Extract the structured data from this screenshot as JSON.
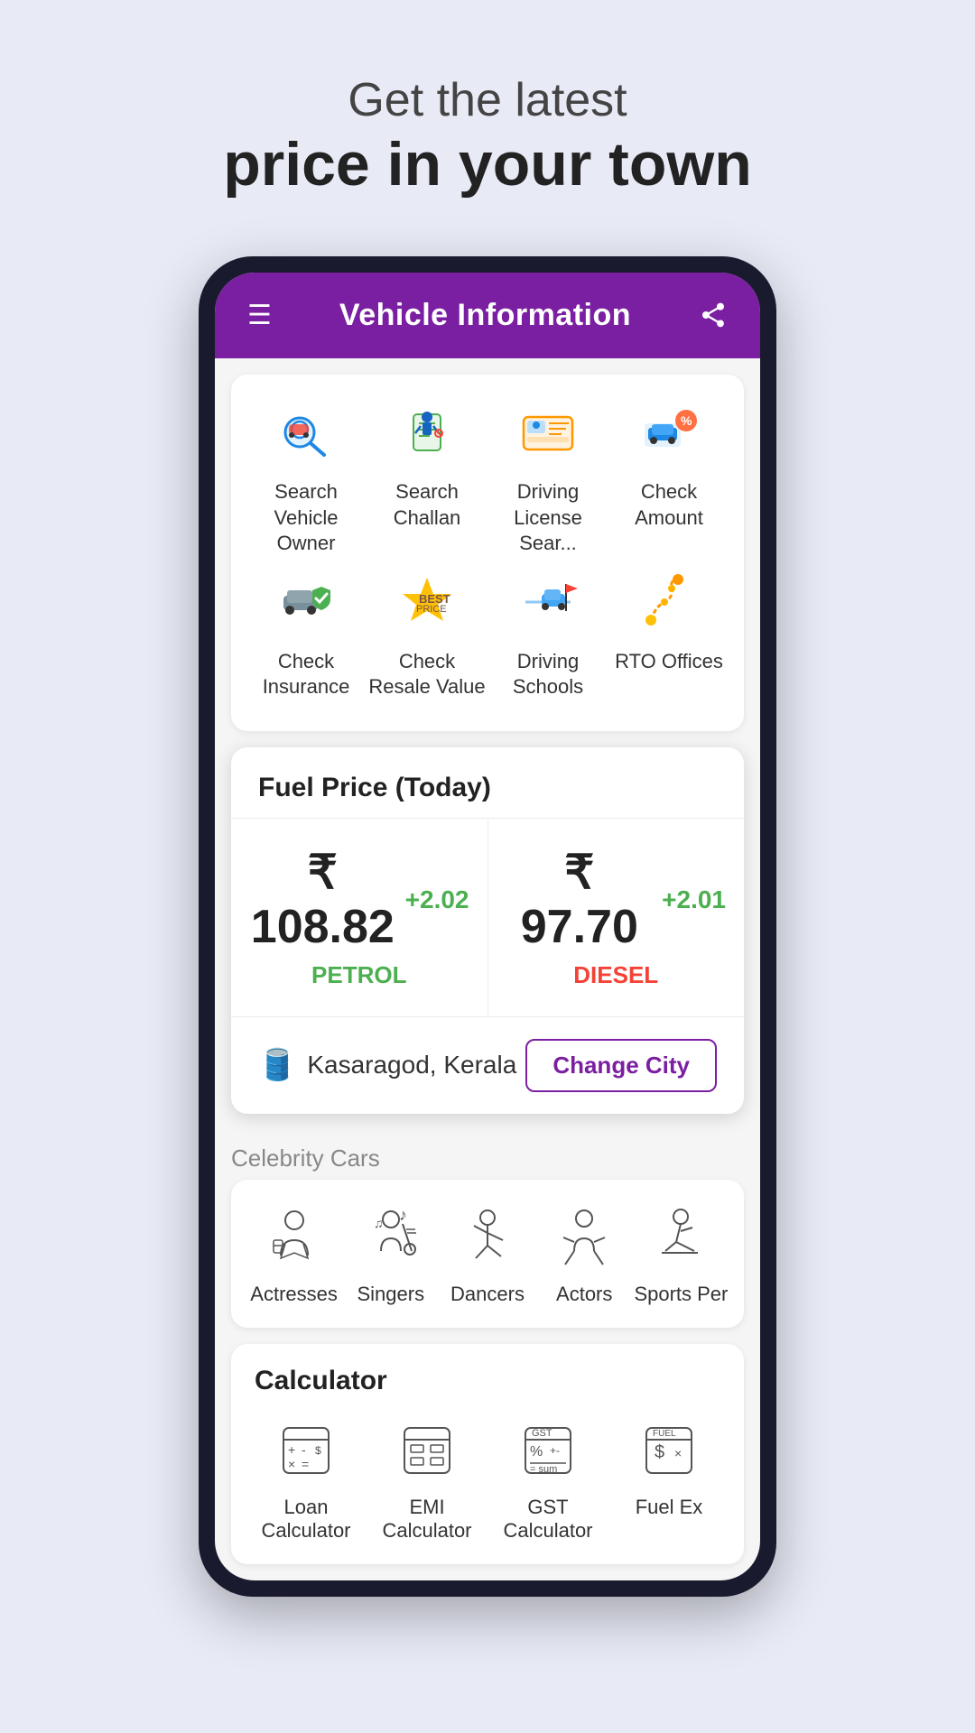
{
  "hero": {
    "subtitle": "Get the latest",
    "title": "price in your town"
  },
  "app_bar": {
    "title": "Vehicle Information"
  },
  "grid_row1": [
    {
      "id": "search-vehicle-owner",
      "label": "Search Vehicle Owner",
      "icon": "🔍"
    },
    {
      "id": "search-challan",
      "label": "Search Challan",
      "icon": "👮"
    },
    {
      "id": "driving-license",
      "label": "Driving License Sear...",
      "icon": "🪪"
    },
    {
      "id": "check-amount",
      "label": "Check Amount",
      "icon": "🏷️"
    }
  ],
  "grid_row2": [
    {
      "id": "check-insurance",
      "label": "Check Insurance",
      "icon": "🛡️"
    },
    {
      "id": "check-resale-value",
      "label": "Check Resale Value",
      "icon": "💰"
    },
    {
      "id": "driving-schools",
      "label": "Driving Schools",
      "icon": "🚗"
    },
    {
      "id": "rto-offices",
      "label": "RTO Offices",
      "icon": "📍"
    }
  ],
  "fuel": {
    "header": "Fuel Price (Today)",
    "petrol": {
      "amount": "₹ 108.82",
      "change": "+2.02",
      "label": "PETROL"
    },
    "diesel": {
      "amount": "₹ 97.70",
      "change": "+2.01",
      "label": "DIESEL"
    },
    "city": "Kasaragod, Kerala",
    "change_city_btn": "Change City"
  },
  "celebrity": {
    "header": "Celebrity Cars",
    "items": [
      {
        "id": "actresses",
        "label": "Actresses"
      },
      {
        "id": "singers",
        "label": "Singers"
      },
      {
        "id": "dancers",
        "label": "Dancers"
      },
      {
        "id": "actors",
        "label": "Actors"
      },
      {
        "id": "sports-persons",
        "label": "Sports Per"
      }
    ]
  },
  "calculator": {
    "header": "Calculator",
    "items": [
      {
        "id": "loan-calculator",
        "label": "Loan Calculator"
      },
      {
        "id": "emi-calculator",
        "label": "EMI Calculator"
      },
      {
        "id": "gst-calculator",
        "label": "GST Calculator"
      },
      {
        "id": "fuel-ex",
        "label": "Fuel Ex"
      }
    ]
  }
}
